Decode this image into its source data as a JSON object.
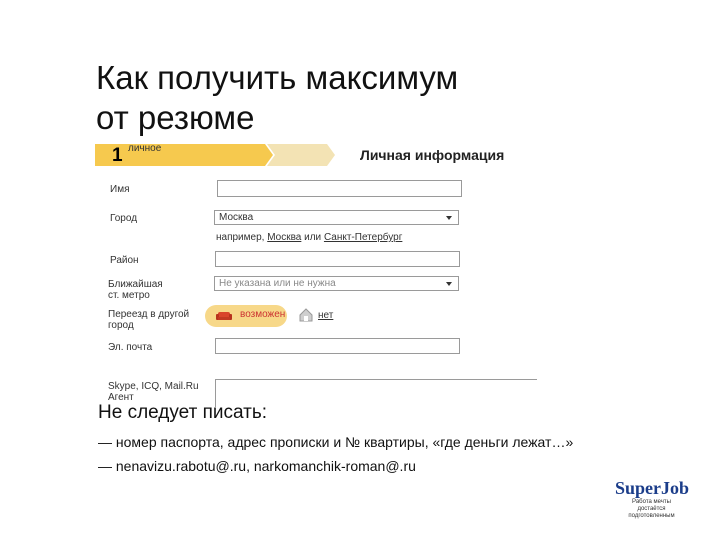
{
  "slide": {
    "title_line1": "Как получить максимум",
    "title_line2": "от резюме"
  },
  "form": {
    "step_number": "1",
    "step_label": "личное",
    "section_title": "Личная информация",
    "name_label": "Имя",
    "city_label": "Город",
    "city_value": "Москва",
    "city_hint_prefix": "например,",
    "city_hint_link1": "Москва",
    "city_hint_mid": "или",
    "city_hint_link2": "Санкт-Петербург",
    "district_label": "Район",
    "metro_label_line1": "Ближайшая",
    "metro_label_line2": "ст. метро",
    "metro_placeholder": "Не указана или не нужна",
    "relocate_label_line1": "Переезд в другой",
    "relocate_label_line2": "город",
    "relocate_yes": "возможен",
    "relocate_no": "нет",
    "email_label": "Эл. почта",
    "im_label_line1": "Skype, ICQ, Mail.Ru",
    "im_label_line2": "Агент"
  },
  "warning": {
    "heading": "Не следует писать:",
    "bullet1": "— номер паспорта, адрес прописки и № квартиры, «где деньги лежат…»",
    "bullet2": "— nenavizu.rabotu@.ru, narkomanchik-roman@.ru"
  },
  "logo": {
    "super": "Super",
    "job": "Job",
    "tagline_line1": "Работа мечты",
    "tagline_line2": "достаётся подготовленным"
  },
  "colors": {
    "step_bar": "#f6c94e",
    "relocate_highlight": "#f7d889",
    "logo_blue": "#1b3d8a"
  }
}
